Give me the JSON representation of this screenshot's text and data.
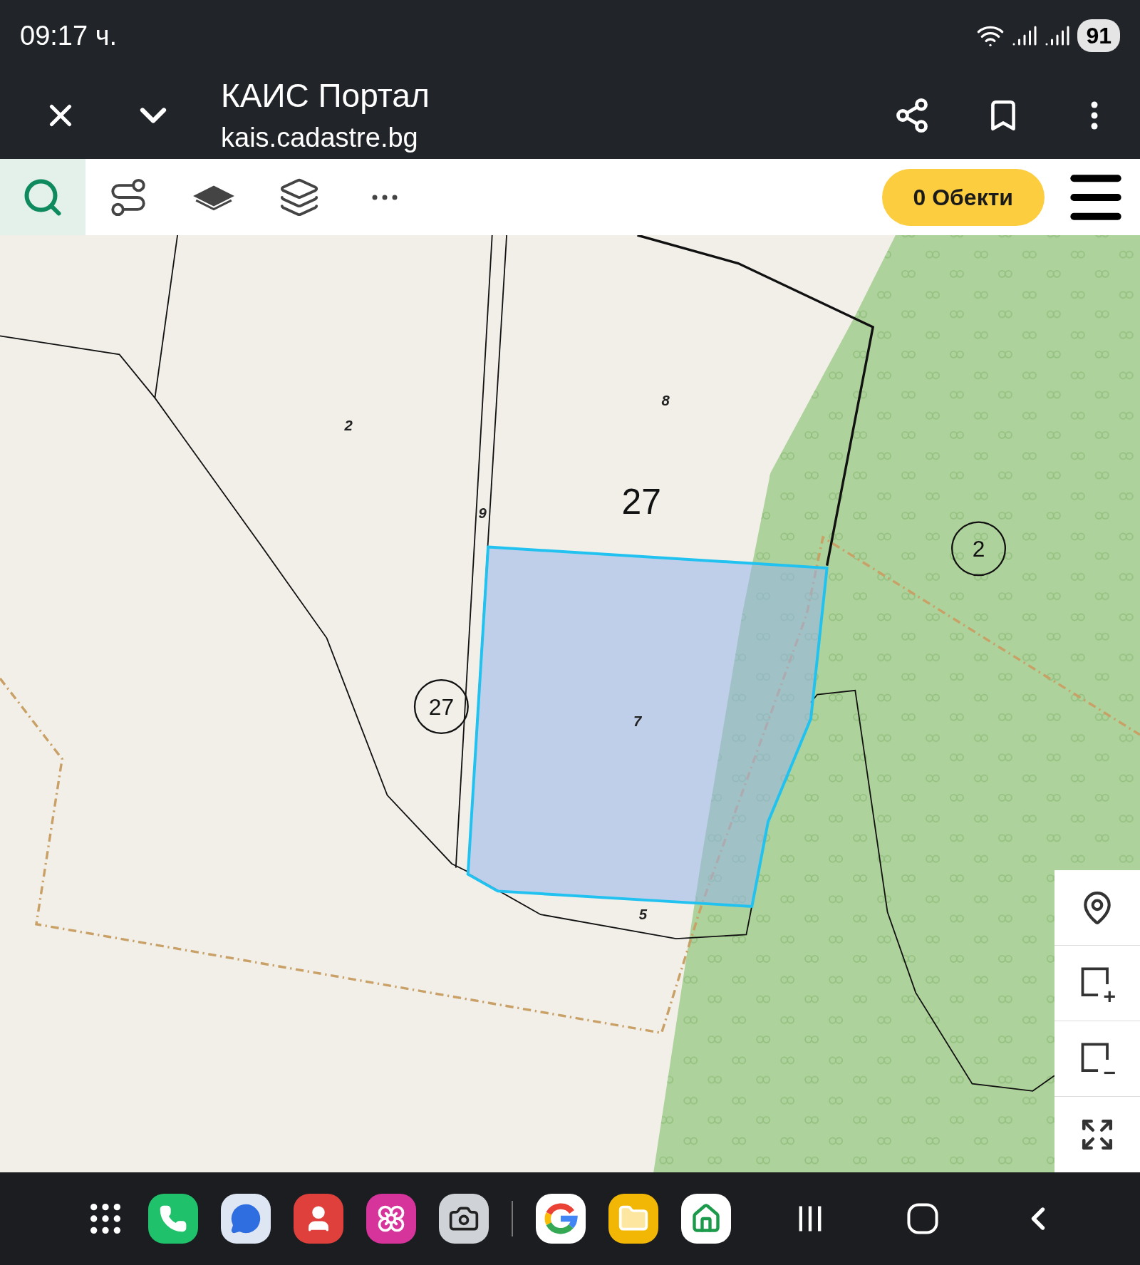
{
  "status_bar": {
    "time": "09:17 ч.",
    "battery": "91"
  },
  "browser": {
    "title": "КАИС Портал",
    "url": "kais.cadastre.bg"
  },
  "toolbar": {
    "tools": [
      {
        "kind": "search",
        "selected": true
      },
      {
        "kind": "route",
        "selected": false
      },
      {
        "kind": "layers-filled",
        "selected": false
      },
      {
        "kind": "layers",
        "selected": false
      },
      {
        "kind": "more",
        "selected": false
      }
    ],
    "objects_button": "0 Обекти"
  },
  "map": {
    "labels": [
      {
        "kind": "parcel",
        "text": "2"
      },
      {
        "kind": "parcel",
        "text": "8"
      },
      {
        "kind": "parcel",
        "text": "9"
      },
      {
        "kind": "block",
        "text": "27"
      },
      {
        "kind": "parcel",
        "text": "7"
      },
      {
        "kind": "parcel",
        "text": "5"
      },
      {
        "kind": "circled",
        "text": "2"
      },
      {
        "kind": "circled",
        "text": "27"
      }
    ]
  }
}
